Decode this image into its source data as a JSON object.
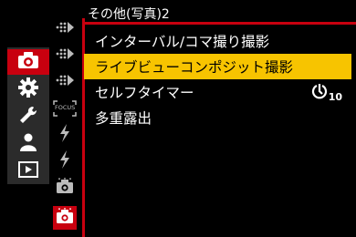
{
  "header": {
    "title": "その他(写真)2"
  },
  "main_tabs": [
    {
      "icon": "camera-icon",
      "active": true
    },
    {
      "icon": "gear-icon",
      "active": false
    },
    {
      "icon": "wrench-icon",
      "active": false
    },
    {
      "icon": "person-icon",
      "active": false
    },
    {
      "icon": "playback-icon",
      "active": false
    }
  ],
  "sub_tabs": [
    {
      "icon": "dots-arrow-icon"
    },
    {
      "icon": "dots-arrow-icon"
    },
    {
      "icon": "dots-arrow-icon"
    },
    {
      "icon": "focus-icon",
      "label": "FOCUS"
    },
    {
      "icon": "flash-icon"
    },
    {
      "icon": "flash-icon"
    },
    {
      "icon": "camera-small-icon"
    },
    {
      "icon": "camera-small-icon",
      "active": true
    }
  ],
  "menu": {
    "items": [
      {
        "label": "インターバル/コマ撮り撮影",
        "selected": false
      },
      {
        "label": "ライブビューコンポジット撮影",
        "selected": true
      },
      {
        "label": "セルフタイマー",
        "selected": false,
        "value_icon": "self-timer-icon",
        "value": "10"
      },
      {
        "label": "多重露出",
        "selected": false
      }
    ]
  },
  "colors": {
    "accent": "#c8000f",
    "highlight": "#f7c400",
    "tab_bg": "#2b2b2b"
  }
}
